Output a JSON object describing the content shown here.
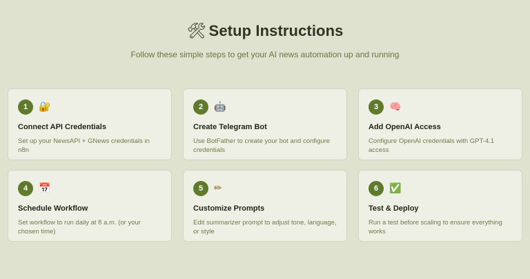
{
  "header": {
    "title_icon": "🛠",
    "title": "Setup Instructions",
    "subtitle": "Follow these simple steps to get your AI news automation up and running"
  },
  "steps": [
    {
      "number": "1",
      "icon": "🔐",
      "icon_name": "lock-key-icon",
      "title": "Connect API Credentials",
      "description": "Set up your NewsAPI + GNews credentials in n8n"
    },
    {
      "number": "2",
      "icon": "🤖",
      "icon_name": "robot-icon",
      "title": "Create Telegram Bot",
      "description": "Use BotFather to create your bot and configure credentials"
    },
    {
      "number": "3",
      "icon": "🧠",
      "icon_name": "brain-icon",
      "title": "Add OpenAI Access",
      "description": "Configure OpenAI credentials with GPT-4.1 access"
    },
    {
      "number": "4",
      "icon": "📅",
      "icon_name": "calendar-icon",
      "title": "Schedule Workflow",
      "description": "Set workflow to run daily at 8 a.m. (or your chosen time)"
    },
    {
      "number": "5",
      "icon": "✏",
      "icon_name": "pencil-icon",
      "title": "Customize Prompts",
      "description": "Edit summarizer prompt to adjust tone, language, or style"
    },
    {
      "number": "6",
      "icon": "✅",
      "icon_name": "check-mark-icon",
      "title": "Test & Deploy",
      "description": "Run a test before scaling to ensure everything works"
    }
  ],
  "colors": {
    "background": "#dfe2cf",
    "card": "#eef0e6",
    "accent": "#5f7a2c",
    "subtitle": "#69753f"
  }
}
